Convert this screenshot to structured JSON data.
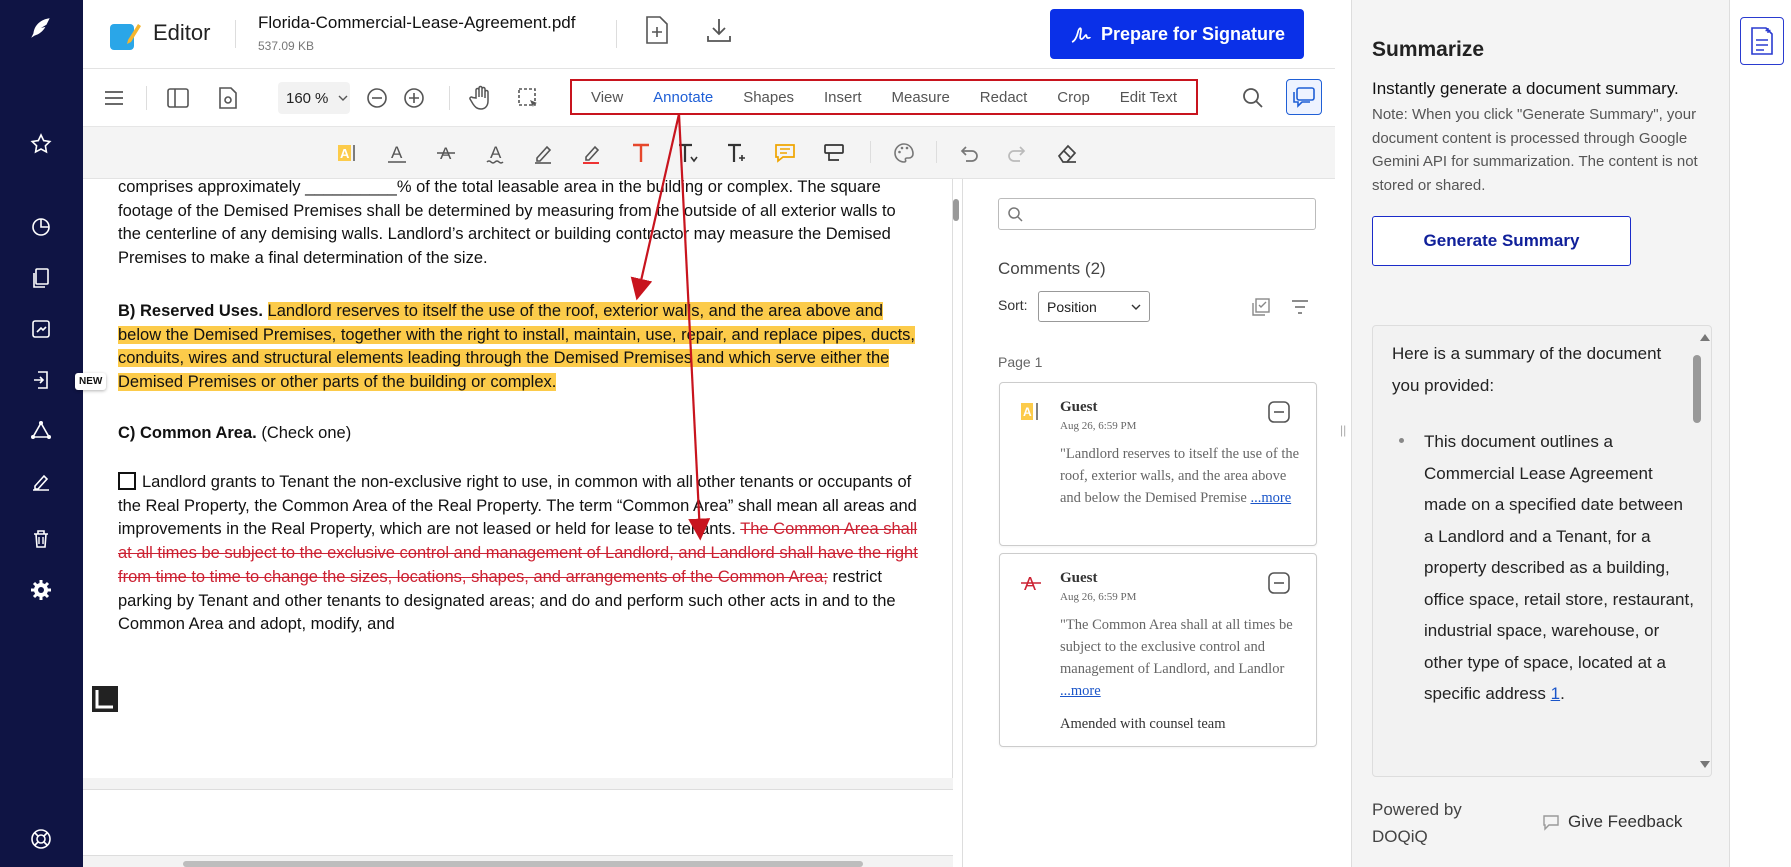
{
  "header": {
    "app_title": "Editor",
    "file_name": "Florida-Commercial-Lease-Agreement.pdf",
    "file_size": "537.09 KB",
    "prepare_label": "Prepare for Signature"
  },
  "rail": {
    "new_badge": "NEW",
    "icons": [
      "logo-feather-icon",
      "star-icon",
      "pie-chart-icon",
      "documents-icon",
      "convert-icon",
      "exit-doc-icon",
      "triangle-share-icon",
      "signature-icon",
      "trash-icon",
      "settings-icon",
      "help-icon"
    ]
  },
  "toolbar": {
    "zoom_value": "160",
    "zoom_unit": "%",
    "tabs": [
      "View",
      "Annotate",
      "Shapes",
      "Insert",
      "Measure",
      "Redact",
      "Crop",
      "Edit Text"
    ],
    "active_tab": "Annotate"
  },
  "document": {
    "p1": "comprises approximately __________% of the total leasable area in the building or complex. The square footage of the Demised Premises shall be determined by measuring from the outside of all exterior walls to the centerline of any demising walls. Landlord’s architect or building contractor may measure the Demised Premises to make a final determination of the size.",
    "p2_heading": "B) Reserved Uses.",
    "p2_highlight": "Landlord reserves to itself the use of the roof, exterior walls, and the area above and below the Demised Premises, together with the right to install, maintain, use, repair, and replace pipes, ducts, conduits, wires and structural elements leading through the Demised Premises and which serve either the Demised Premises or other parts of the building or complex.",
    "p3_heading": "C) Common Area.",
    "p3_suffix": " (Check one)",
    "p4_start": "Landlord grants to Tenant the non-exclusive right to use, in common with all other tenants or occupants of the Real Property, the Common Area of the Real Property. The term “Common Area” shall mean all areas and improvements in the Real Property, which are not leased or held for lease to tenants. ",
    "p4_strike": "The Common Area shall at all times be subject to the exclusive control and management of Landlord, and Landlord shall have the right from time to time to change the sizes, locations, shapes, and arrangements of the Common Area;",
    "p4_end": " restrict parking by Tenant and other tenants to designated areas; and do and perform such other acts in and to the Common Area and adopt, modify, and"
  },
  "comments": {
    "search_placeholder": "",
    "title": "Comments (2)",
    "sort_label": "Sort:",
    "sort_value": "Position",
    "page_label": "Page 1",
    "items": [
      {
        "author": "Guest",
        "date": "Aug 26, 6:59 PM",
        "text": "\"Landlord reserves to itself the use of the roof, exterior walls, and the area above and below the Demised Premise",
        "more": "...more",
        "note": ""
      },
      {
        "author": "Guest",
        "date": "Aug 26, 6:59 PM",
        "text": "\"The Common Area shall at all times be subject to the exclusive control and management of Landlord, and Landlor",
        "more": "...more",
        "note": "Amended with counsel team"
      }
    ]
  },
  "summarize": {
    "title": "Summarize",
    "subtitle": "Instantly generate a document summary.",
    "note": "Note: When you click \"Generate Summary\", your document content is processed through Google Gemini API for summarization. The content is not stored or shared.",
    "button": "Generate Summary",
    "intro": "Here is a summary of the document you provided:",
    "bullet": "This document outlines a Commercial Lease Agreement made on a specified date between a Landlord and a Tenant, for a property described as a building, office space, retail store, restaurant, industrial space, warehouse, or other type of space, located at a specific address ",
    "ref": "1",
    "bullet_end": ".",
    "powered_line1": "Powered by",
    "powered_line2": "DOQiQ",
    "feedback": "Give Feedback"
  },
  "colors": {
    "rail_bg": "#0f1444",
    "primary_button": "#0a30e8",
    "highlight": "#fccb4a",
    "strike": "#c23",
    "tab_box_border": "#c8141e",
    "arrow": "#c8141e"
  }
}
